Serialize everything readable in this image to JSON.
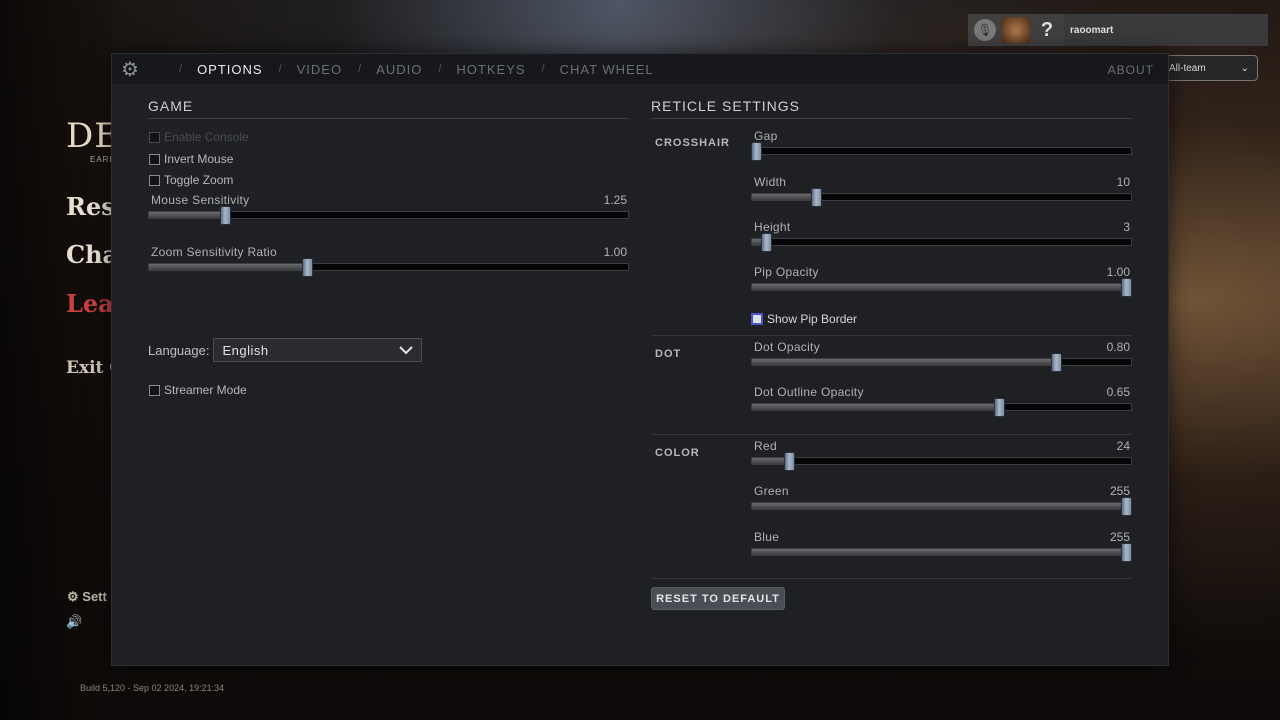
{
  "background": {
    "logo_text": "DE",
    "logo_sub": "EARL",
    "menu": [
      {
        "label": "Res"
      },
      {
        "label": "Cha"
      },
      {
        "label": "Leav"
      },
      {
        "label": "Exit G"
      }
    ],
    "settings_label": "Sett",
    "build_info": "Build 5,120 - Sep 02 2024, 19:21:34"
  },
  "user": {
    "name": "raoomart",
    "help_glyph": "?",
    "team_select": "All-team"
  },
  "tabs": [
    {
      "label": "OPTIONS",
      "active": true
    },
    {
      "label": "VIDEO",
      "active": false
    },
    {
      "label": "AUDIO",
      "active": false
    },
    {
      "label": "HOTKEYS",
      "active": false
    },
    {
      "label": "CHAT WHEEL",
      "active": false
    }
  ],
  "about_label": "ABOUT",
  "game": {
    "title": "GAME",
    "checkboxes": {
      "enable_console": {
        "label": "Enable Console",
        "checked": false,
        "disabled": true
      },
      "invert_mouse": {
        "label": "Invert Mouse",
        "checked": false
      },
      "toggle_zoom": {
        "label": "Toggle Zoom",
        "checked": false
      },
      "streamer_mode": {
        "label": "Streamer Mode",
        "checked": false
      }
    },
    "sliders": {
      "mouse_sensitivity": {
        "label": "Mouse Sensitivity",
        "value": "1.25",
        "fraction": 0.16
      },
      "zoom_sensitivity": {
        "label": "Zoom Sensitivity Ratio",
        "value": "1.00",
        "fraction": 0.33
      }
    },
    "language": {
      "label": "Language:",
      "value": "English"
    }
  },
  "reticle": {
    "title": "RETICLE SETTINGS",
    "crosshair": {
      "label": "CROSSHAIR",
      "gap": {
        "label": "Gap",
        "value": "",
        "fraction": 0.01
      },
      "width": {
        "label": "Width",
        "value": "10",
        "fraction": 0.17
      },
      "height": {
        "label": "Height",
        "value": "3",
        "fraction": 0.04
      },
      "pip_opacity": {
        "label": "Pip Opacity",
        "value": "1.00",
        "fraction": 1.0
      },
      "show_pip_border": {
        "label": "Show Pip Border",
        "checked": false
      }
    },
    "dot": {
      "label": "DOT",
      "dot_opacity": {
        "label": "Dot Opacity",
        "value": "0.80",
        "fraction": 0.8
      },
      "dot_outline_opacity": {
        "label": "Dot Outline Opacity",
        "value": "0.65",
        "fraction": 0.65
      }
    },
    "color": {
      "label": "COLOR",
      "red": {
        "label": "Red",
        "value": "24",
        "fraction": 0.1
      },
      "green": {
        "label": "Green",
        "value": "255",
        "fraction": 1.0
      },
      "blue": {
        "label": "Blue",
        "value": "255",
        "fraction": 1.0
      }
    },
    "reset_label": "RESET TO DEFAULT"
  }
}
